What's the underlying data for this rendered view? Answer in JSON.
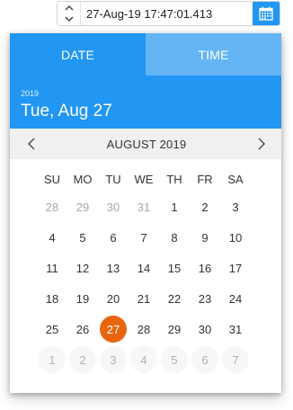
{
  "input": {
    "value": "27-Aug-19 17:47:01.413"
  },
  "popup": {
    "tabs": [
      {
        "label": "DATE",
        "active": true
      },
      {
        "label": "TIME",
        "active": false
      }
    ],
    "header": {
      "year": "2019",
      "selected_date": "Tue, Aug 27"
    },
    "month_label": "AUGUST 2019",
    "weekdays": [
      "SU",
      "MO",
      "TU",
      "WE",
      "TH",
      "FR",
      "SA"
    ],
    "weeks": [
      [
        {
          "d": "28",
          "m": true
        },
        {
          "d": "29",
          "m": true
        },
        {
          "d": "30",
          "m": true
        },
        {
          "d": "31",
          "m": true
        },
        {
          "d": "1"
        },
        {
          "d": "2"
        },
        {
          "d": "3"
        }
      ],
      [
        {
          "d": "4"
        },
        {
          "d": "5"
        },
        {
          "d": "6"
        },
        {
          "d": "7"
        },
        {
          "d": "8"
        },
        {
          "d": "9"
        },
        {
          "d": "10"
        }
      ],
      [
        {
          "d": "11"
        },
        {
          "d": "12"
        },
        {
          "d": "13"
        },
        {
          "d": "14"
        },
        {
          "d": "15"
        },
        {
          "d": "16"
        },
        {
          "d": "17"
        }
      ],
      [
        {
          "d": "18"
        },
        {
          "d": "19"
        },
        {
          "d": "20"
        },
        {
          "d": "21"
        },
        {
          "d": "22"
        },
        {
          "d": "23"
        },
        {
          "d": "24"
        }
      ],
      [
        {
          "d": "25"
        },
        {
          "d": "26"
        },
        {
          "d": "27",
          "sel": true
        },
        {
          "d": "28"
        },
        {
          "d": "29"
        },
        {
          "d": "30"
        },
        {
          "d": "31"
        }
      ],
      [
        {
          "d": "1",
          "m": true
        },
        {
          "d": "2",
          "m": true
        },
        {
          "d": "3",
          "m": true
        },
        {
          "d": "4",
          "m": true
        },
        {
          "d": "5",
          "m": true
        },
        {
          "d": "6",
          "m": true
        },
        {
          "d": "7",
          "m": true
        }
      ]
    ]
  },
  "colors": {
    "accent": "#2196f3",
    "accent_light": "#64b5f6",
    "selected_day": "#e8650d"
  },
  "icons": {
    "spin_up": "chevron-up-icon",
    "spin_down": "chevron-down-icon",
    "calendar": "calendar-icon",
    "prev": "chevron-left-icon",
    "next": "chevron-right-icon"
  }
}
